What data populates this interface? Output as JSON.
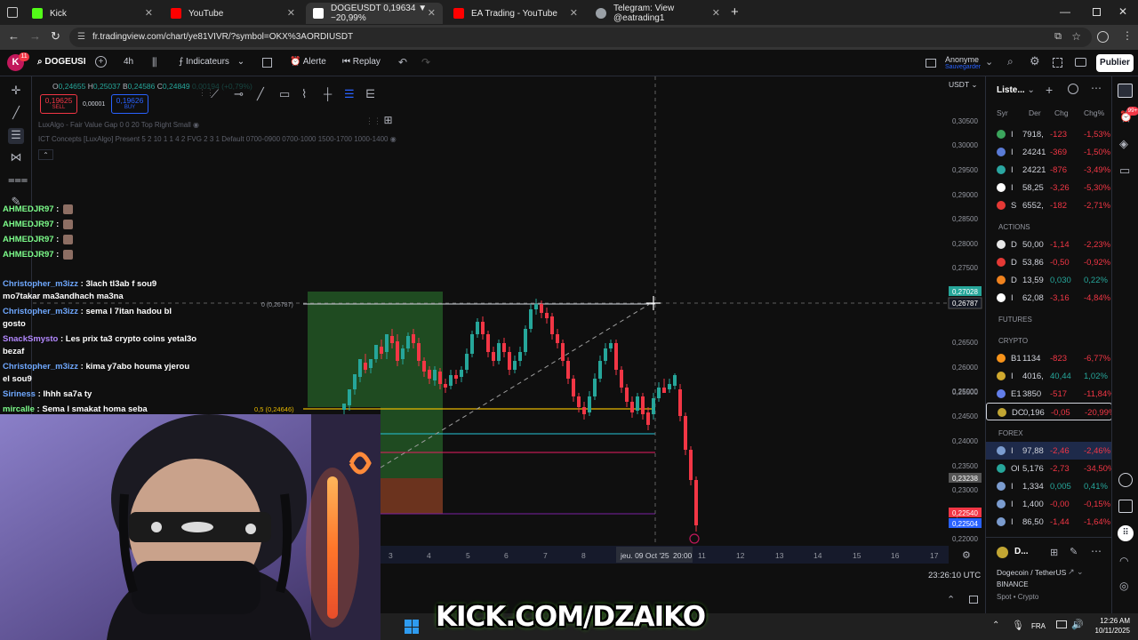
{
  "browser": {
    "tabs": [
      {
        "label": "Kick",
        "icon": "kick-icon",
        "color": "#53fc18",
        "active": false
      },
      {
        "label": "YouTube",
        "icon": "youtube-icon",
        "color": "#ff0000",
        "active": false
      },
      {
        "label": "DOGEUSDT 0,19634 ▼ −20,99%",
        "icon": "tradingview-icon",
        "color": "#ffffff",
        "active": true
      },
      {
        "label": "EA Trading - YouTube",
        "icon": "youtube-icon",
        "color": "#ff0000",
        "active": false
      },
      {
        "label": "Telegram: View @eatrading1",
        "icon": "globe-icon",
        "color": "#9aa0a6",
        "active": false
      }
    ],
    "url": "fr.tradingview.com/chart/ye81VIVR/?symbol=OKX%3AORDIUSDT"
  },
  "tv": {
    "avatar_letter": "K",
    "avatar_badge": "11",
    "symbol": "DOGEUSI",
    "interval": "4h",
    "indicators": "Indicateurs",
    "alert": "Alerte",
    "replay": "Replay",
    "user": "Anonyme",
    "saved": "Sauvegarder",
    "publish": "Publier",
    "ohlc": {
      "o_label": "O",
      "o": "0,24655",
      "h_label": "H",
      "h": "0,25037",
      "b_label": "B",
      "b": "0,24586",
      "c_label": "C",
      "c": "0,24849",
      "change": "0,00194 (+0,79%)"
    },
    "sell_price": "0,19625",
    "sell_label": "SELL",
    "spread": "0,00001",
    "buy_price": "0,19626",
    "buy_label": "BUY",
    "indicator1": "LuxAlgo - Fair Value Gap 0 0 20 Top Right Small",
    "indicator2": "ICT Concepts [LuxAlgo] Present 5 2 10 1 1 4 2 FVG 2 3 1 Default 0700-0900 0700-1000 1500-1700 1000-1400",
    "currency": "USDT",
    "price_labels": [
      "0,30500",
      "0,30000",
      "0,29500",
      "0,29000",
      "0,28500",
      "0,28000",
      "0,27500",
      "0,26500",
      "0,26000",
      "0,25500",
      "0,25000",
      "0,24500",
      "0,24000",
      "0,23500",
      "0,23000",
      "0,22500",
      "0,22000"
    ],
    "tag_green": "0,27028",
    "tag_cross": "0,26787",
    "tag_grey": "0,23238",
    "tag_red": "0,22540",
    "tag_blue": "0,22504",
    "fib0": "0 (0,26787)",
    "fib05": "0,5 (0,24646)",
    "time_labels": [
      "3",
      "4",
      "5",
      "6",
      "7",
      "8",
      "11",
      "12",
      "13",
      "14",
      "15",
      "16",
      "17"
    ],
    "time_cursor": "jeu. 09 Oct '25",
    "time_cursor2": "20:00",
    "clock": "23:26:10 UTC"
  },
  "watchlist": {
    "title": "Liste...",
    "cols": [
      "Syr",
      "Der",
      "Chg",
      "Chg%"
    ],
    "rows1": [
      {
        "badge": "#3ba55c",
        "sym": "I",
        "last": "7918,",
        "chg": "-123",
        "pct": "-1,53%"
      },
      {
        "badge": "#5a7bd6",
        "sym": "I",
        "last": "24241",
        "chg": "-369",
        "pct": "-1,50%"
      },
      {
        "badge": "#2aa6a1",
        "sym": "I",
        "last": "24221",
        "chg": "-876",
        "pct": "-3,49%"
      },
      {
        "badge": "#ffffff",
        "sym": "I",
        "last": "58,25",
        "chg": "-3,26",
        "pct": "-5,30%"
      },
      {
        "badge": "#e53935",
        "sym": "S",
        "last": "6552,",
        "chg": "-182",
        "pct": "-2,71%"
      }
    ],
    "sect_actions": "ACTIONS",
    "rows2": [
      {
        "badge": "#e8e8e8",
        "sym": "D",
        "last": "50,00",
        "chg": "-1,14",
        "pct": "-2,23%",
        "up": false
      },
      {
        "badge": "#e53935",
        "sym": "D",
        "last": "53,86",
        "chg": "-0,50",
        "pct": "-0,92%",
        "up": false
      },
      {
        "badge": "#f0821e",
        "sym": "D",
        "last": "13,59",
        "chg": "0,030",
        "pct": "0,22%",
        "up": true
      },
      {
        "badge": "#ffffff",
        "sym": "I",
        "last": "62,08",
        "chg": "-3,16",
        "pct": "-4,84%",
        "up": false
      }
    ],
    "sect_futures": "FUTURES",
    "sect_crypto": "CRYPTO",
    "rows3": [
      {
        "badge": "#f7931a",
        "sym": "B1",
        "last": "1134",
        "chg": "-823",
        "pct": "-6,77%",
        "up": false
      },
      {
        "badge": "#d0a92e",
        "sym": "I",
        "last": "4016,",
        "chg": "40,44",
        "pct": "1,02%",
        "up": true
      },
      {
        "badge": "#627eea",
        "sym": "E1",
        "last": "3850",
        "chg": "-517",
        "pct": "-11,84%",
        "up": false
      },
      {
        "badge": "#c2a633",
        "sym": "DC",
        "last": "0,196",
        "chg": "-0,05",
        "pct": "-20,99%",
        "up": false
      }
    ],
    "sect_forex": "FOREX",
    "rows4": [
      {
        "badge": "#7b9ccf",
        "sym": "I",
        "last": "97,88",
        "chg": "-2,46",
        "pct": "-2,46%",
        "up": false
      },
      {
        "badge": "#26a69a",
        "sym": "Ol",
        "last": "5,176",
        "chg": "-2,73",
        "pct": "-34,50%",
        "up": false
      },
      {
        "badge": "#7b9ccf",
        "sym": "I",
        "last": "1,334",
        "chg": "0,005",
        "pct": "0,41%",
        "up": true
      },
      {
        "badge": "#7b9ccf",
        "sym": "I",
        "last": "1,400",
        "chg": "-0,00",
        "pct": "-0,15%",
        "up": false
      },
      {
        "badge": "#7b9ccf",
        "sym": "I",
        "last": "86,50",
        "chg": "-1,44",
        "pct": "-1,64%",
        "up": false
      }
    ],
    "detail_sym": "D...",
    "detail_name": "Dogecoin / TetherUS",
    "detail_exchange": "BINANCE",
    "detail_spot": "Spot",
    "detail_type": "Crypto"
  },
  "chat": [
    {
      "user": "AHMEDJR97",
      "text": ""
    },
    {
      "user": "AHMEDJR97",
      "text": ""
    },
    {
      "user": "AHMEDJR97",
      "text": ""
    },
    {
      "user": "AHMEDJR97",
      "text": ""
    },
    {
      "user": "Christopher_m3izz",
      "text": "3lach tl3ab f sou9",
      "text2": "mo7takar ma3andhach ma3na"
    },
    {
      "user": "Christopher_m3izz",
      "text": "sema l 7itan hadou bl",
      "text2": "gosto"
    },
    {
      "user": "SnackSmysto",
      "text": "Les prix ta3 crypto coins yetal3o",
      "text2": "bezaf"
    },
    {
      "user": "Christopher_m3izz",
      "text": "kima y7abo houma yjerou",
      "text2": "el sou9"
    },
    {
      "user": "Siriness",
      "text": "Ihhh sa7a ty"
    },
    {
      "user": "mircalle",
      "text": "Sema l smakat homa seba"
    },
    {
      "user": "Siriness",
      "text": ""
    }
  ],
  "overlay": {
    "kick_text": "KICK.COM/DZAIKO"
  },
  "taskbar": {
    "lang": "FRA",
    "time": "12:26 AM",
    "date": "10/11/2025"
  },
  "colors": {
    "up": "#26a69a",
    "down": "#f23645",
    "bg": "#0f0f0f",
    "accent": "#2962ff",
    "green_box": "#2e7d32",
    "kick": "#53fc18"
  }
}
